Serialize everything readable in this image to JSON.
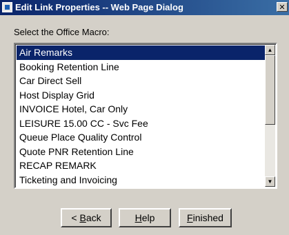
{
  "window": {
    "title": "Edit Link Properties -- Web Page Dialog",
    "close_glyph": "✕"
  },
  "prompt": "Select the Office Macro:",
  "macros": [
    "Air Remarks",
    "Booking Retention Line",
    "Car Direct Sell",
    "Host Display Grid",
    "INVOICE Hotel, Car Only",
    "LEISURE 15.00 CC - Svc Fee",
    "Queue Place Quality Control",
    "Quote PNR Retention Line",
    "RECAP REMARK",
    "Ticketing and Invoicing"
  ],
  "selected_index": 0,
  "scrollbar": {
    "up_glyph": "▲",
    "down_glyph": "▼"
  },
  "buttons": {
    "back": {
      "prefix": "< ",
      "mnemonic": "B",
      "rest": "ack"
    },
    "help": {
      "prefix": "",
      "mnemonic": "H",
      "rest": "elp"
    },
    "finished": {
      "prefix": "",
      "mnemonic": "F",
      "rest": "inished"
    }
  },
  "colors": {
    "titlebar": "#0a246a",
    "selection": "#0a246a",
    "face": "#d4d0c8"
  }
}
